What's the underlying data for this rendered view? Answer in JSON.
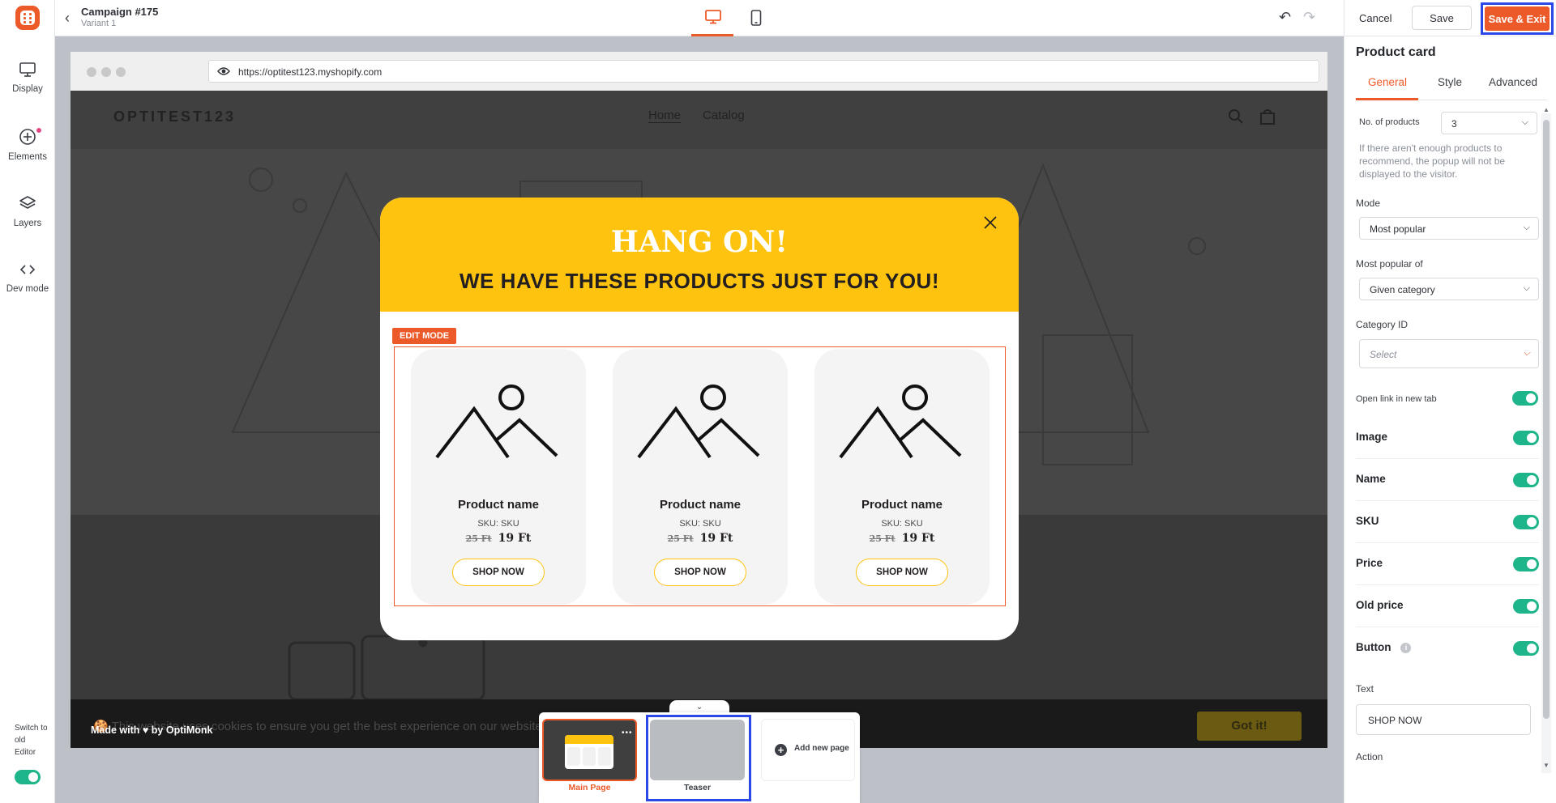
{
  "sidebar": {
    "items": [
      {
        "label": "Display",
        "icon": "monitor-icon"
      },
      {
        "label": "Elements",
        "icon": "plus-circle-icon"
      },
      {
        "label": "Layers",
        "icon": "layers-icon"
      },
      {
        "label": "Dev mode",
        "icon": "code-icon"
      }
    ],
    "switch_old": "Switch to old Editor"
  },
  "topbar": {
    "campaign_title": "Campaign #175",
    "variant": "Variant 1"
  },
  "actions": {
    "cancel": "Cancel",
    "save": "Save",
    "save_exit": "Save & Exit"
  },
  "browser": {
    "url": "https://optitest123.myshopify.com"
  },
  "site": {
    "brand": "OPTITEST123",
    "nav_home": "Home",
    "nav_catalog": "Catalog",
    "cookie_text": "🍪 This website uses cookies to ensure you get the best experience on our website",
    "cookie_button": "Got it!",
    "made_with": "Made with ♥ by OptiMonk"
  },
  "popup": {
    "headline": "HANG ON!",
    "subhead": "WE HAVE THESE PRODUCTS JUST FOR YOU!",
    "edit_mode": "EDIT MODE",
    "products": [
      {
        "name": "Product name",
        "sku": "SKU: SKU",
        "old_price": "25 Ft",
        "price": "19 Ft",
        "button": "SHOP NOW"
      },
      {
        "name": "Product name",
        "sku": "SKU: SKU",
        "old_price": "25 Ft",
        "price": "19 Ft",
        "button": "SHOP NOW"
      },
      {
        "name": "Product name",
        "sku": "SKU: SKU",
        "old_price": "25 Ft",
        "price": "19 Ft",
        "button": "SHOP NOW"
      }
    ],
    "colors": {
      "accent": "#fec30f",
      "edit": "#ed5a29"
    }
  },
  "pages": {
    "main": "Main Page",
    "teaser": "Teaser",
    "add": "Add new page"
  },
  "panel": {
    "title": "Product card",
    "tabs": [
      "General",
      "Style",
      "Advanced"
    ],
    "no_products_label": "No. of products",
    "no_products_value": "3",
    "help": "If there aren't enough products to recommend, the popup will not be displayed to the visitor.",
    "mode_label": "Mode",
    "mode_value": "Most popular",
    "popular_of_label": "Most popular of",
    "popular_of_value": "Given category",
    "category_label": "Category ID",
    "category_placeholder": "Select",
    "open_link_label": "Open link in new tab",
    "toggles": [
      {
        "label": "Image",
        "on": true
      },
      {
        "label": "Name",
        "on": true
      },
      {
        "label": "SKU",
        "on": true
      },
      {
        "label": "Price",
        "on": true
      },
      {
        "label": "Old price",
        "on": true
      },
      {
        "label": "Button",
        "on": true
      }
    ],
    "text_label": "Text",
    "text_value": "SHOP NOW",
    "action_label": "Action"
  }
}
